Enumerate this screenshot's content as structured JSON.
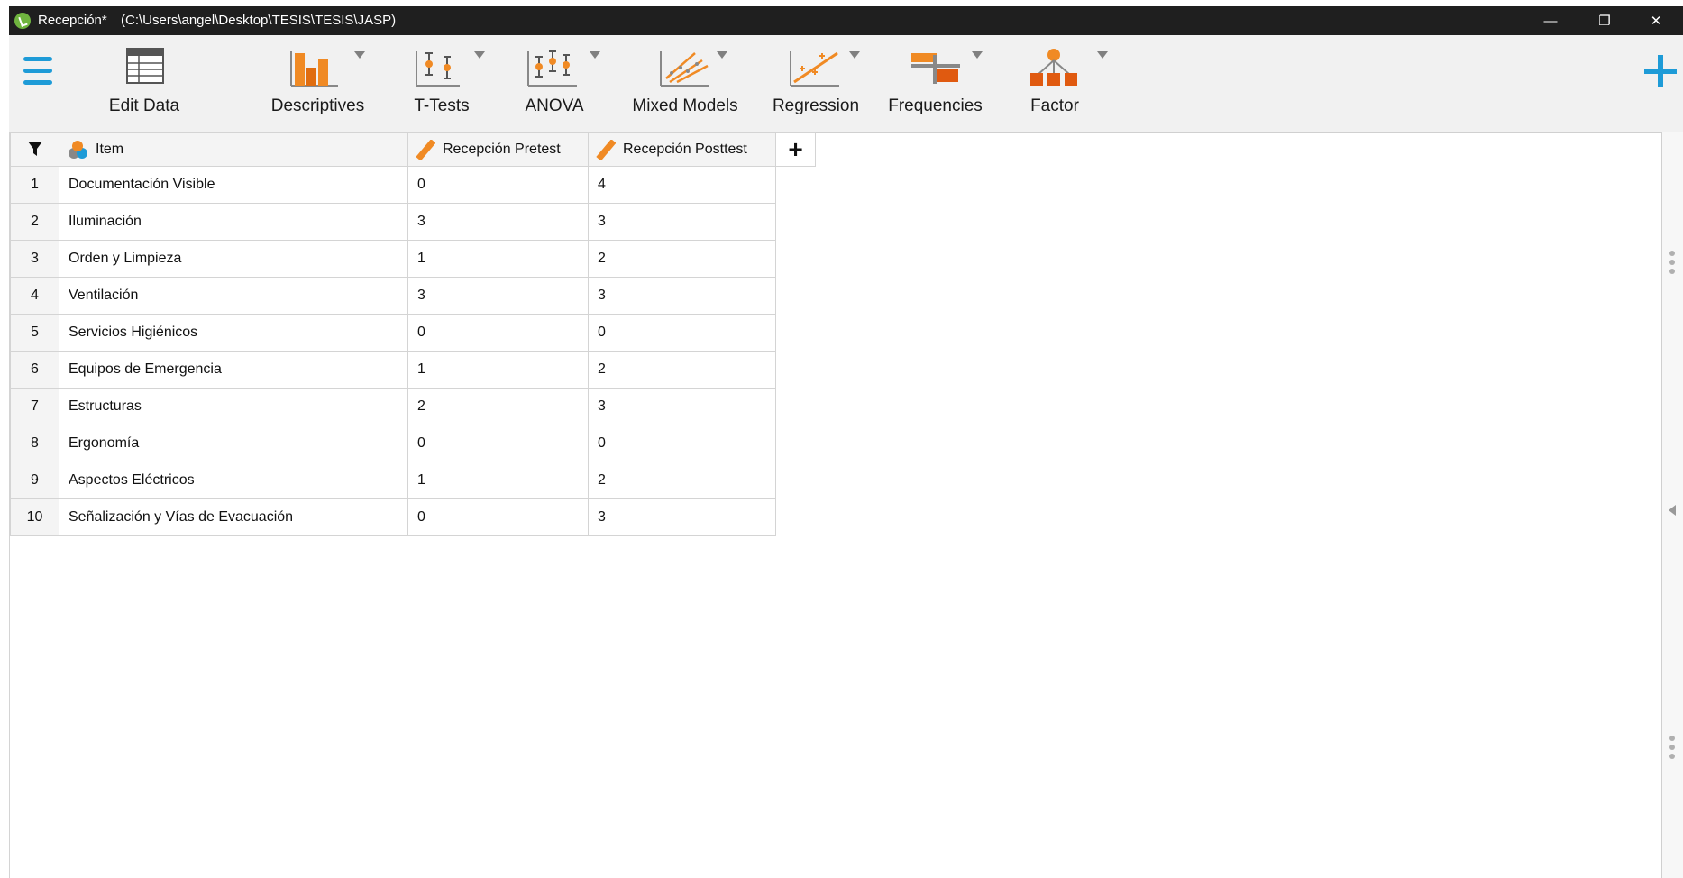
{
  "window": {
    "title": "Recepción*",
    "path": "(C:\\Users\\angel\\Desktop\\TESIS\\TESIS\\JASP)",
    "minimize_glyph": "—",
    "restore_glyph": "❐",
    "close_glyph": "✕"
  },
  "toolbar": {
    "menu_icon": "hamburger-menu-icon",
    "add_icon": "plus-icon",
    "items": [
      {
        "label": "Edit Data",
        "icon": "spreadsheet-icon"
      },
      {
        "label": "Descriptives",
        "icon": "bar-chart-icon"
      },
      {
        "label": "T-Tests",
        "icon": "t-test-icon"
      },
      {
        "label": "ANOVA",
        "icon": "anova-icon"
      },
      {
        "label": "Mixed Models",
        "icon": "mixed-models-icon"
      },
      {
        "label": "Regression",
        "icon": "regression-icon"
      },
      {
        "label": "Frequencies",
        "icon": "frequencies-icon"
      },
      {
        "label": "Factor",
        "icon": "factor-icon"
      }
    ]
  },
  "grid": {
    "columns": [
      {
        "label": "Item",
        "type_icon": "nominal-text-icon"
      },
      {
        "label": "Recepción Pretest",
        "type_icon": "scale-ruler-icon"
      },
      {
        "label": "Recepción Posttest",
        "type_icon": "scale-ruler-icon"
      }
    ],
    "add_column_glyph": "+",
    "rows": [
      {
        "n": "1",
        "item": "Documentación Visible",
        "pre": "0",
        "post": "4"
      },
      {
        "n": "2",
        "item": "Iluminación",
        "pre": "3",
        "post": "3"
      },
      {
        "n": "3",
        "item": "Orden y Limpieza",
        "pre": "1",
        "post": "2"
      },
      {
        "n": "4",
        "item": "Ventilación",
        "pre": "3",
        "post": "3"
      },
      {
        "n": "5",
        "item": "Servicios Higiénicos",
        "pre": "0",
        "post": "0"
      },
      {
        "n": "6",
        "item": "Equipos de Emergencia",
        "pre": "1",
        "post": "2"
      },
      {
        "n": "7",
        "item": "Estructuras",
        "pre": "2",
        "post": "3"
      },
      {
        "n": "8",
        "item": "Ergonomía",
        "pre": "0",
        "post": "0"
      },
      {
        "n": "9",
        "item": "Aspectos Eléctricos",
        "pre": "1",
        "post": "2"
      },
      {
        "n": "10",
        "item": "Señalización y Vías de Evacuación",
        "pre": "0",
        "post": "3"
      }
    ]
  },
  "colors": {
    "accent_blue": "#1e9bd7",
    "jasp_orange": "#f08a24",
    "titlebar": "#1f1f1f"
  }
}
